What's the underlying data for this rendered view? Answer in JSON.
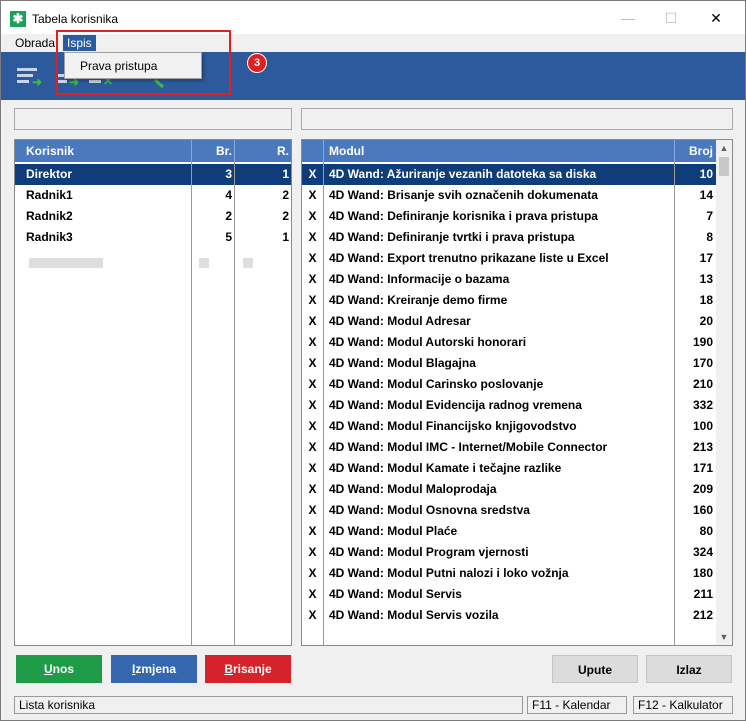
{
  "window": {
    "title": "Tabela korisnika",
    "minimize": "—",
    "maximize": "☐",
    "close": "✕"
  },
  "menu": {
    "items": [
      "Obrada",
      "Ispis"
    ],
    "dropdown_items": [
      "Prava pristupa"
    ]
  },
  "annotation": {
    "badge": "3"
  },
  "users": {
    "headers": [
      "Korisnik",
      "Br.",
      "R."
    ],
    "rows": [
      {
        "name": "Direktor",
        "br": "3",
        "r": "1"
      },
      {
        "name": "Radnik1",
        "br": "4",
        "r": "2"
      },
      {
        "name": "Radnik2",
        "br": "2",
        "r": "2"
      },
      {
        "name": "Radnik3",
        "br": "5",
        "r": "1"
      }
    ]
  },
  "modules": {
    "headers": [
      "Modul",
      "Broj"
    ],
    "rows": [
      {
        "mark": "X",
        "name": "4D Wand: Ažuriranje vezanih datoteka sa diska",
        "num": "10"
      },
      {
        "mark": "X",
        "name": "4D Wand: Brisanje svih označenih dokumenata",
        "num": "14"
      },
      {
        "mark": "X",
        "name": "4D Wand: Definiranje korisnika i prava pristupa",
        "num": "7"
      },
      {
        "mark": "X",
        "name": "4D Wand: Definiranje tvrtki i prava pristupa",
        "num": "8"
      },
      {
        "mark": "X",
        "name": "4D Wand: Export trenutno prikazane liste u Excel",
        "num": "17"
      },
      {
        "mark": "X",
        "name": "4D Wand: Informacije o bazama",
        "num": "13"
      },
      {
        "mark": "X",
        "name": "4D Wand: Kreiranje demo firme",
        "num": "18"
      },
      {
        "mark": "X",
        "name": "4D Wand: Modul Adresar",
        "num": "20"
      },
      {
        "mark": "X",
        "name": "4D Wand: Modul Autorski honorari",
        "num": "190"
      },
      {
        "mark": "X",
        "name": "4D Wand: Modul Blagajna",
        "num": "170"
      },
      {
        "mark": "X",
        "name": "4D Wand: Modul Carinsko poslovanje",
        "num": "210"
      },
      {
        "mark": "X",
        "name": "4D Wand: Modul Evidencija radnog vremena",
        "num": "332"
      },
      {
        "mark": "X",
        "name": "4D Wand: Modul Financijsko knjigovodstvo",
        "num": "100"
      },
      {
        "mark": "X",
        "name": "4D Wand: Modul IMC - Internet/Mobile Connector",
        "num": "213"
      },
      {
        "mark": "X",
        "name": "4D Wand: Modul Kamate i tečajne razlike",
        "num": "171"
      },
      {
        "mark": "X",
        "name": "4D Wand: Modul Maloprodaja",
        "num": "209"
      },
      {
        "mark": "X",
        "name": "4D Wand: Modul Osnovna sredstva",
        "num": "160"
      },
      {
        "mark": "X",
        "name": "4D Wand: Modul Plaće",
        "num": "80"
      },
      {
        "mark": "X",
        "name": "4D Wand: Modul Program vjernosti",
        "num": "324"
      },
      {
        "mark": "X",
        "name": "4D Wand: Modul Putni nalozi i loko vožnja",
        "num": "180"
      },
      {
        "mark": "X",
        "name": "4D Wand: Modul Servis",
        "num": "211"
      },
      {
        "mark": "X",
        "name": "4D Wand: Modul Servis vozila",
        "num": "212"
      }
    ]
  },
  "buttons": {
    "unos_first": "U",
    "unos_rest": "nos",
    "izmjena_first": "I",
    "izmjena_rest": "zmjena",
    "brisanje_first": "B",
    "brisanje_rest": "risanje",
    "upute": "Upute",
    "izlaz": "Izlaz"
  },
  "status": {
    "left": "Lista korisnika",
    "f11": "F11 - Kalendar",
    "f12": "F12 - Kalkulator"
  },
  "colors": {
    "toolbar": "#2d5a9c",
    "header": "#4a79bd",
    "selected_row": "#0f3d7a",
    "btn_green": "#1f9c48",
    "btn_blue": "#3567b0",
    "btn_red": "#d6232b",
    "annotation_red": "#e02020"
  }
}
